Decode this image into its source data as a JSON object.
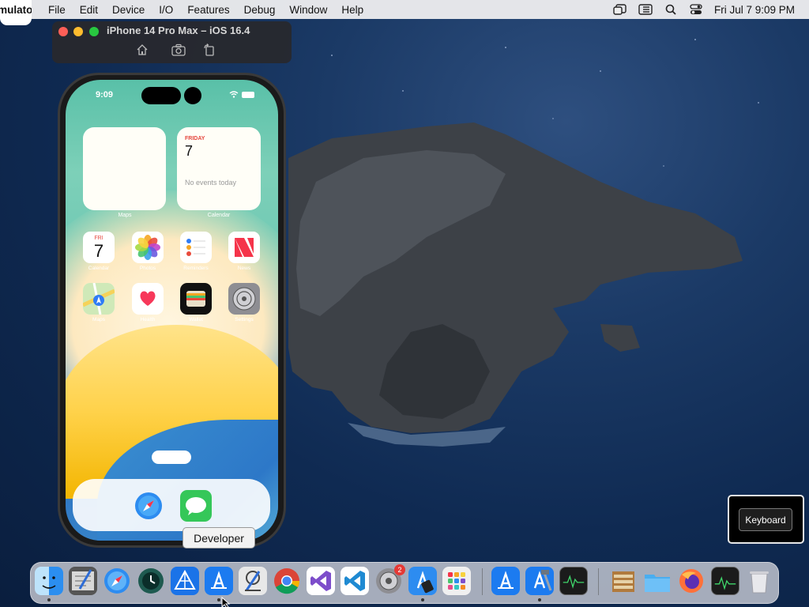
{
  "menubar": {
    "app_name": "Simulator",
    "items": [
      "File",
      "Edit",
      "Device",
      "I/O",
      "Features",
      "Debug",
      "Window",
      "Help"
    ],
    "clock": "Fri Jul 7  9:09 PM"
  },
  "simulator": {
    "window_title": "iPhone 14 Pro Max – iOS 16.4"
  },
  "phone": {
    "status_time": "9:09",
    "widgets": {
      "maps_label": "Maps",
      "calendar_day": "FRIDAY",
      "calendar_date": "7",
      "calendar_empty": "No events today",
      "calendar_label": "Calendar"
    },
    "apps_row1": [
      {
        "label": "Calendar",
        "icon": "calendar-icon",
        "day": "FRI",
        "date": "7"
      },
      {
        "label": "Photos",
        "icon": "photos-icon"
      },
      {
        "label": "Reminders",
        "icon": "reminders-icon"
      },
      {
        "label": "News",
        "icon": "news-icon"
      }
    ],
    "apps_row2": [
      {
        "label": "Maps",
        "icon": "maps-icon"
      },
      {
        "label": "Health",
        "icon": "health-icon"
      },
      {
        "label": "Wallet",
        "icon": "wallet-icon"
      },
      {
        "label": "Settings",
        "icon": "settings-icon"
      }
    ],
    "dock_apps": [
      "safari-icon",
      "messages-icon"
    ]
  },
  "tooltip": "Developer",
  "keyboard_button": "Keyboard",
  "dock": {
    "apps": [
      "finder-icon",
      "script-editor-icon",
      "safari-icon",
      "time-machine-icon",
      "transporter-icon",
      "developer-icon",
      "instruments-icon",
      "chrome-icon",
      "visual-studio-icon",
      "vscode-icon",
      "system-settings-icon",
      "xcode-create-ml-icon",
      "launchpad-icon",
      "app-store-icon",
      "xcode-icon",
      "console-icon",
      "archive-utility-icon",
      "downloads-folder-icon",
      "firefox-icon",
      "activity-monitor-icon",
      "trash-icon"
    ],
    "settings_badge": "2"
  }
}
